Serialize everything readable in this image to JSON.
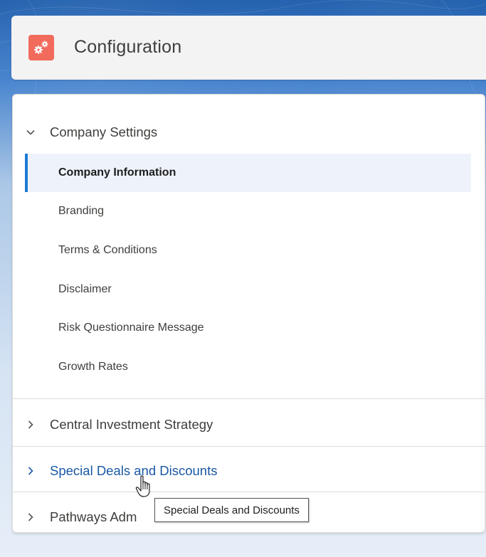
{
  "header": {
    "title": "Configuration",
    "icon": "gears-icon",
    "icon_color": "#f26a5b"
  },
  "sections": [
    {
      "label": "Company Settings",
      "expanded": true,
      "items": [
        {
          "label": "Company Information",
          "active": true
        },
        {
          "label": "Branding"
        },
        {
          "label": "Terms & Conditions"
        },
        {
          "label": "Disclaimer"
        },
        {
          "label": "Risk Questionnaire Message"
        },
        {
          "label": "Growth Rates"
        }
      ]
    },
    {
      "label": "Central Investment Strategy",
      "expanded": false
    },
    {
      "label": "Special Deals and Discounts",
      "expanded": false,
      "hovered": true
    },
    {
      "label": "Pathways Adm",
      "expanded": false
    }
  ],
  "tooltip": {
    "text": "Special Deals and Discounts"
  },
  "colors": {
    "accent": "#1b7bd7",
    "link": "#1a58a5",
    "active_bg": "#eef3fb"
  }
}
